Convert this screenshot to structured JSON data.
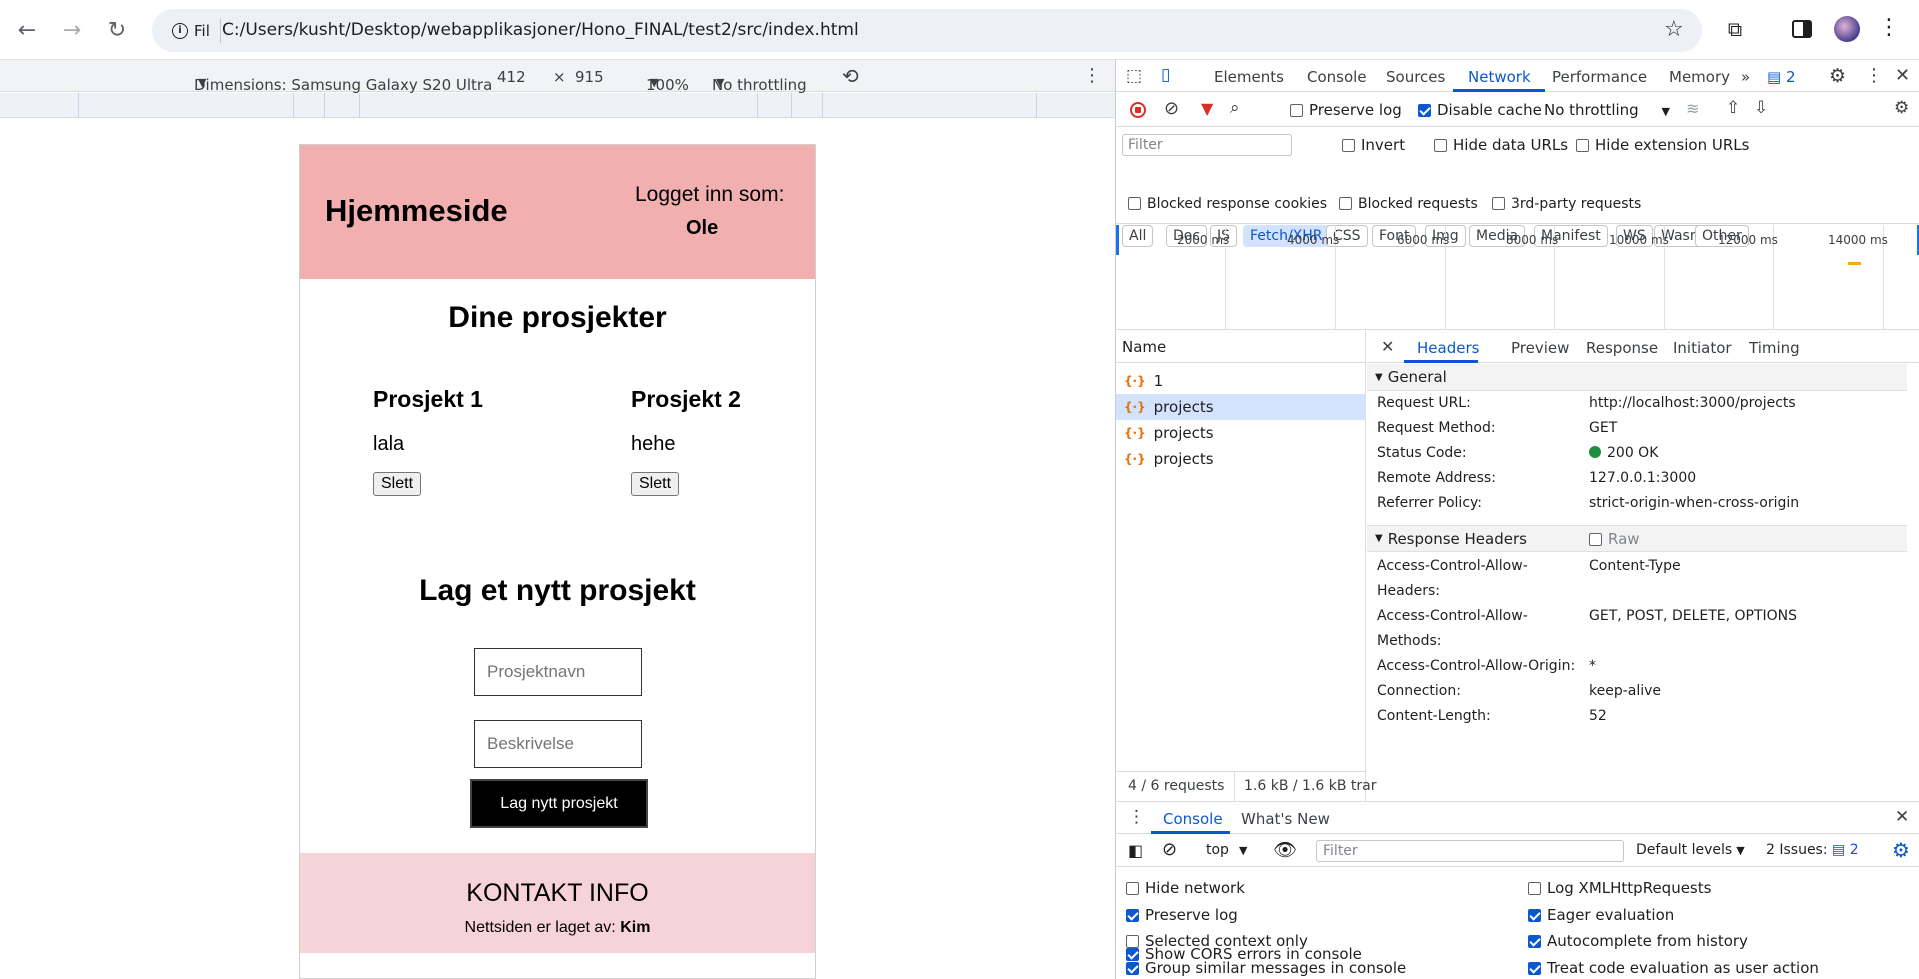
{
  "browser": {
    "site_label": "Fil",
    "url": "C:/Users/kusht/Desktop/webapplikasjoner/Hono_FINAL/test2/src/index.html"
  },
  "device_toolbar": {
    "dimensions": "Dimensions: Samsung Galaxy S20 Ultra",
    "width": "412",
    "times": "×",
    "height": "915",
    "zoom": "100%",
    "throttling": "No throttling"
  },
  "page": {
    "header_title": "Hjemmeside",
    "logged_in_label": "Logget inn som:",
    "user_name": "Ole",
    "projects_heading": "Dine prosjekter",
    "projects": [
      {
        "title": "Prosjekt 1",
        "desc": "lala",
        "delete": "Slett"
      },
      {
        "title": "Prosjekt 2",
        "desc": "hehe",
        "delete": "Slett"
      }
    ],
    "new_heading": "Lag et nytt prosjekt",
    "name_placeholder": "Prosjektnavn",
    "desc_placeholder": "Beskrivelse",
    "create_button": "Lag nytt prosjekt",
    "footer_title": "KONTAKT INFO",
    "footer_text": "Nettsiden er laget av:",
    "footer_author": "Kim"
  },
  "devtools": {
    "tabs": [
      "Elements",
      "Console",
      "Sources",
      "Network",
      "Performance",
      "Memory"
    ],
    "issues_count": "2",
    "preserve_log": "Preserve log",
    "disable_cache": "Disable cache",
    "throttling": "No throttling",
    "filter_placeholder": "Filter",
    "invert": "Invert",
    "hide_data_urls": "Hide data URLs",
    "hide_extension_urls": "Hide extension URLs",
    "type_filters": [
      "All",
      "Doc",
      "JS",
      "Fetch/XHR",
      "CSS",
      "Font",
      "Img",
      "Media",
      "Manifest",
      "WS",
      "Wasm",
      "Other"
    ],
    "blocked_cookies": "Blocked response cookies",
    "blocked_requests": "Blocked requests",
    "third_party": "3rd-party requests",
    "timeline_ticks": [
      "2000 ms",
      "4000 ms",
      "6000 ms",
      "8000 ms",
      "10000 ms",
      "12000 ms",
      "14000 ms"
    ],
    "name_header": "Name",
    "requests": [
      "1",
      "projects",
      "projects",
      "projects"
    ],
    "detail_tabs": [
      "Headers",
      "Preview",
      "Response",
      "Initiator",
      "Timing"
    ],
    "general_label": "General",
    "general": [
      {
        "k": "Request URL:",
        "v": "http://localhost:3000/projects"
      },
      {
        "k": "Request Method:",
        "v": "GET"
      },
      {
        "k": "Status Code:",
        "v": "200 OK"
      },
      {
        "k": "Remote Address:",
        "v": "127.0.0.1:3000"
      },
      {
        "k": "Referrer Policy:",
        "v": "strict-origin-when-cross-origin"
      }
    ],
    "response_headers_label": "Response Headers",
    "raw_label": "Raw",
    "response_headers": [
      {
        "k": "Access-Control-Allow-",
        "k2": "Headers:",
        "v": "Content-Type"
      },
      {
        "k": "Access-Control-Allow-",
        "k2": "Methods:",
        "v": "GET, POST, DELETE, OPTIONS"
      },
      {
        "k": "Access-Control-Allow-Origin:",
        "v": "*"
      },
      {
        "k": "Connection:",
        "v": "keep-alive"
      },
      {
        "k": "Content-Length:",
        "v": "52"
      }
    ],
    "requests_summary": "4 / 6 requests",
    "transfer_summary": "1.6 kB / 1.6 kB trar",
    "console_tab": "Console",
    "whats_new_tab": "What's New",
    "context": "top",
    "console_filter": "Filter",
    "levels": "Default levels",
    "issues_label": "2 Issues:",
    "console_options": [
      {
        "label": "Hide network",
        "checked": false
      },
      {
        "label": "Log XMLHttpRequests",
        "checked": false
      },
      {
        "label": "Preserve log",
        "checked": true
      },
      {
        "label": "Eager evaluation",
        "checked": true
      },
      {
        "label": "Selected context only",
        "checked": false
      },
      {
        "label": "Autocomplete from history",
        "checked": true
      },
      {
        "label": "Group similar messages in console",
        "checked": true
      },
      {
        "label": "Treat code evaluation as user action",
        "checked": true
      },
      {
        "label": "Show CORS errors in console",
        "checked": true
      }
    ]
  },
  "colors": {
    "header_bg": "#f1b0af",
    "footer_bg": "#f6d3d6",
    "accent": "#0b57d0",
    "status_ok": "#1e8e3e"
  }
}
